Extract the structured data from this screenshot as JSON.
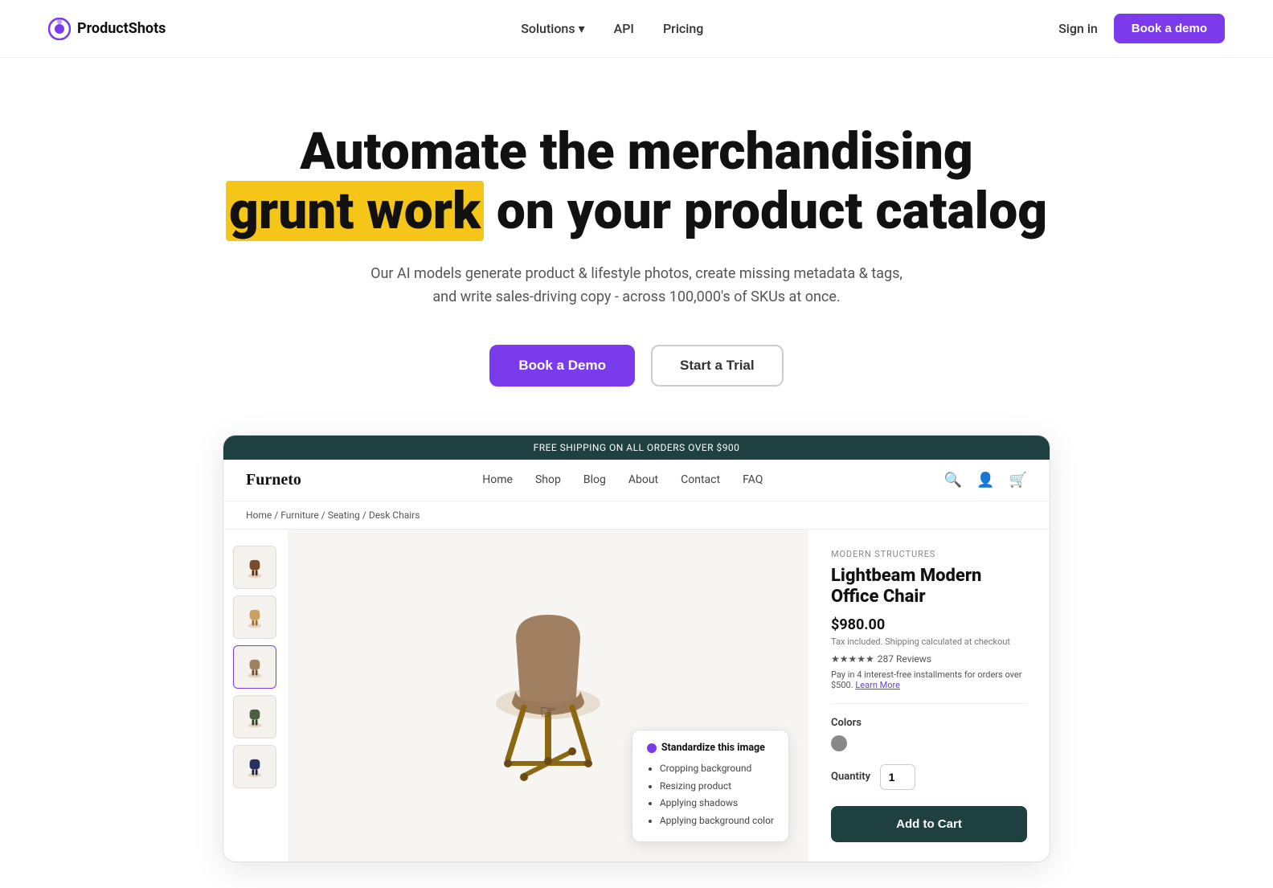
{
  "navbar": {
    "logo_text": "ProductShots",
    "solutions_label": "Solutions",
    "api_label": "API",
    "pricing_label": "Pricing",
    "signin_label": "Sign in",
    "demo_button_label": "Book a demo"
  },
  "hero": {
    "title_line1": "Automate the merchandising",
    "title_highlight": "grunt work",
    "title_line2": " on your product catalog",
    "subtitle_line1": "Our AI models generate product & lifestyle photos, create missing metadata & tags,",
    "subtitle_line2": "and write sales-driving copy - across 100,000's of SKUs at once.",
    "book_demo_label": "Book a Demo",
    "start_trial_label": "Start a Trial"
  },
  "shop_demo": {
    "topbar_text": "FREE SHIPPING ON ALL ORDERS OVER $900",
    "shop_logo": "Furneto",
    "nav_links": [
      "Home",
      "Shop",
      "Blog",
      "About",
      "Contact",
      "FAQ"
    ],
    "breadcrumb": "Home / Furniture / Seating / Desk Chairs",
    "product_brand": "MODERN STRUCTURES",
    "product_title": "Lightbeam Modern Office Chair",
    "product_price": "$980.00",
    "product_tax": "Tax included. Shipping calculated at checkout",
    "stars": "★★★★★",
    "review_count": "287 Reviews",
    "installments": "Pay in 4 interest-free installments for orders over $500.",
    "learn_more": "Learn More",
    "colors_label": "Colors",
    "quantity_label": "Quantity",
    "quantity_value": "1",
    "add_to_cart_label": "Add to Cart",
    "tooltip_title": "Standardize this image",
    "tooltip_items": [
      "Cropping background",
      "Resizing product",
      "Applying shadows",
      "Applying background color"
    ]
  }
}
